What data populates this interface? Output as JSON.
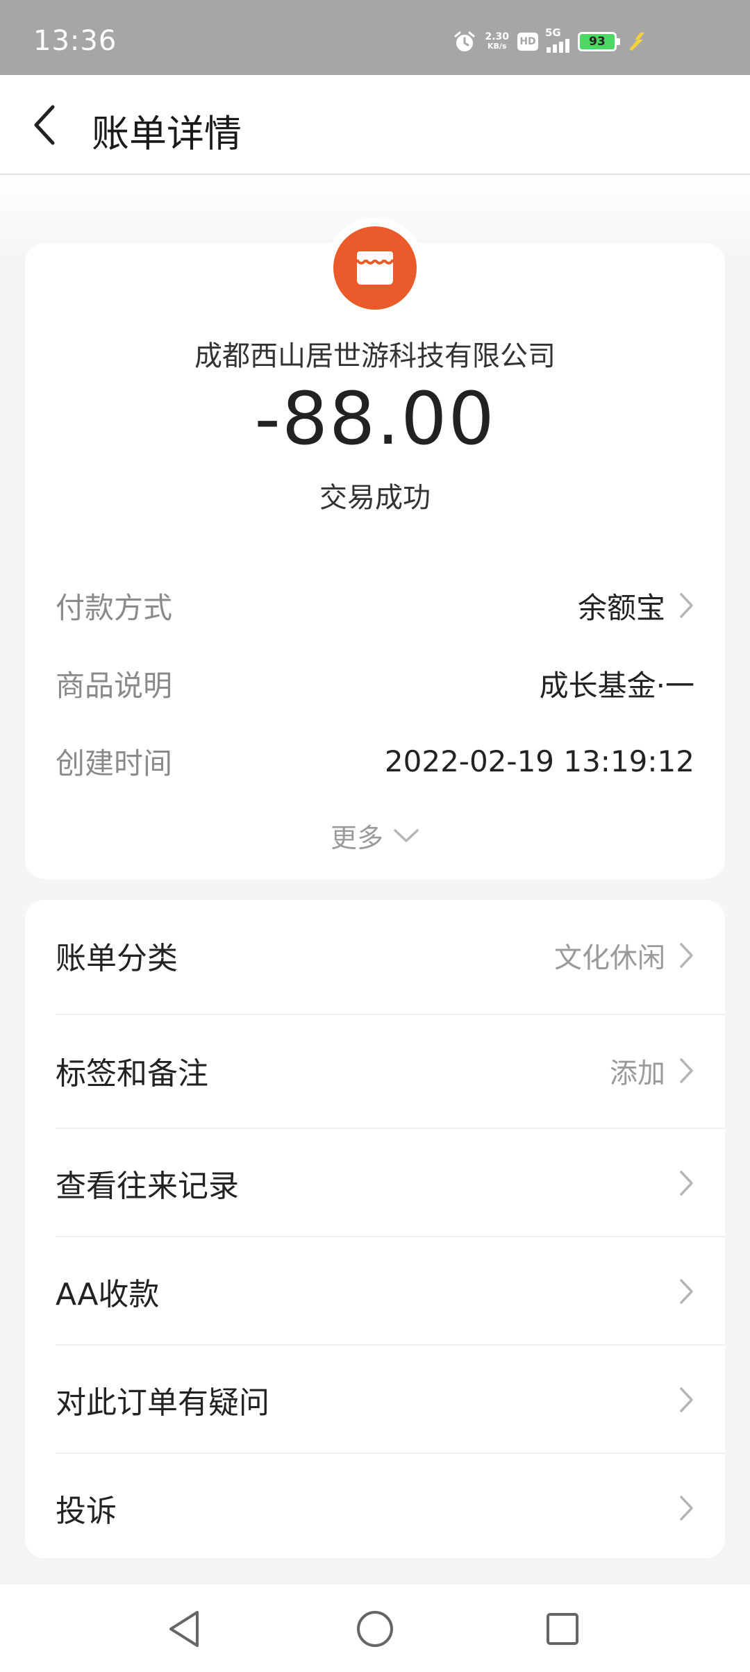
{
  "status_bar": {
    "time": "13:36",
    "net_speed_value": "2.30",
    "net_speed_unit": "KB/s",
    "hd": "HD",
    "network": "5G",
    "battery": "93",
    "icons": [
      "alarm-icon",
      "hd-icon",
      "signal-icon",
      "battery-icon",
      "charging-icon"
    ]
  },
  "header": {
    "title": "账单详情",
    "back_icon": "chevron-left-icon"
  },
  "transaction": {
    "merchant_name": "成都西山居世游科技有限公司",
    "amount": "-88.00",
    "status": "交易成功",
    "merchant_icon": "store-icon",
    "accent_color": "#ea5a2a"
  },
  "details": [
    {
      "label": "付款方式",
      "value": "余额宝",
      "has_arrow": true
    },
    {
      "label": "商品说明",
      "value": "成长基金·一",
      "has_arrow": false
    },
    {
      "label": "创建时间",
      "value": "2022-02-19 13:19:12",
      "has_arrow": false
    }
  ],
  "more_label": "更多",
  "actions": [
    {
      "label": "账单分类",
      "value": "文化休闲"
    },
    {
      "label": "标签和备注",
      "value": "添加"
    },
    {
      "label": "查看往来记录",
      "value": ""
    },
    {
      "label": "AA收款",
      "value": ""
    },
    {
      "label": "对此订单有疑问",
      "value": ""
    },
    {
      "label": "投诉",
      "value": ""
    }
  ],
  "nav_bar": {
    "icons": [
      "back-triangle-icon",
      "home-circle-icon",
      "recents-square-icon"
    ]
  }
}
